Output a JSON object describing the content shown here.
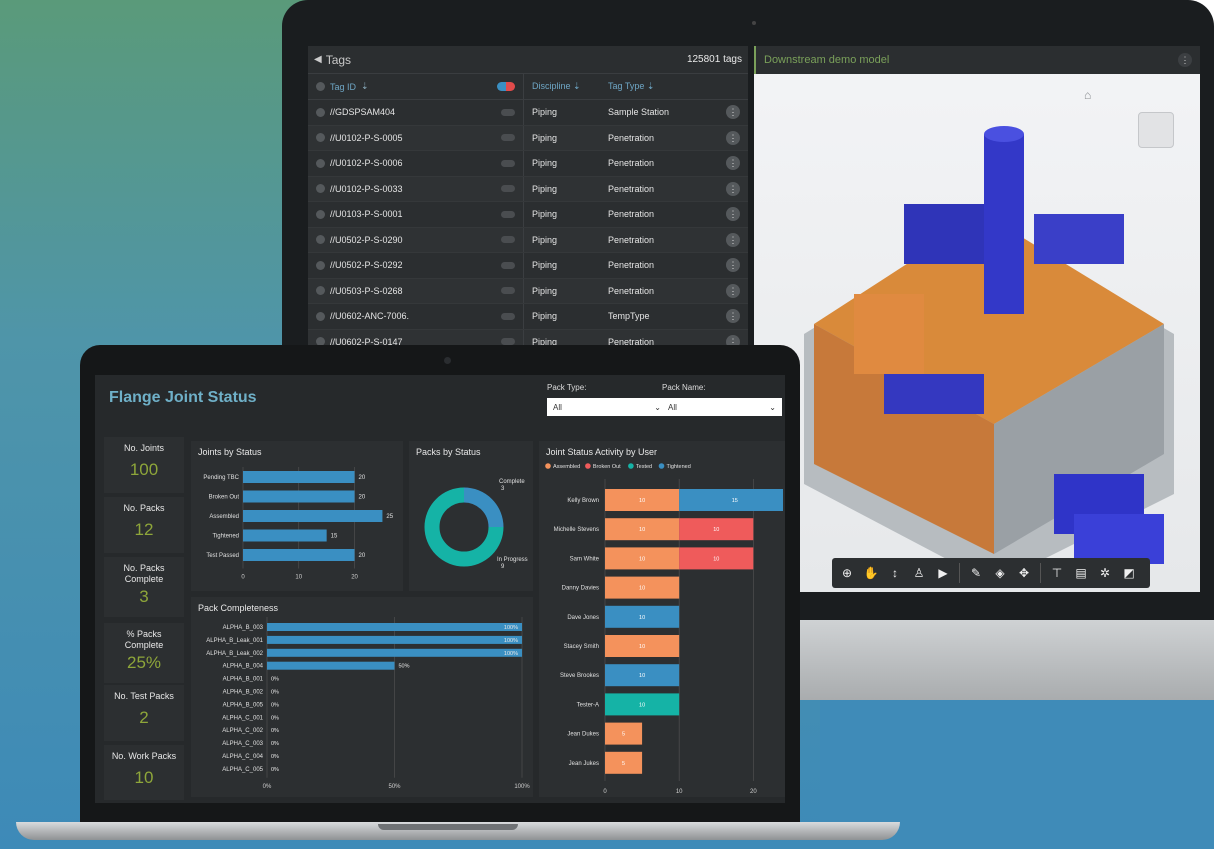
{
  "colors": {
    "accent": "#3a8fc2",
    "green_kpi": "#8ea63a",
    "assembled": "#f4925c",
    "broken_out": "#ef5b5b",
    "tested": "#15b3a6",
    "tightened": "#3a8fc2"
  },
  "tags": {
    "title": "Tags",
    "count": "125801 tags",
    "columns": {
      "id": "Tag ID",
      "discipline": "Discipline",
      "type": "Tag Type"
    },
    "rows": [
      {
        "id": "//GDSPSAM404",
        "discipline": "Piping",
        "type": "Sample Station"
      },
      {
        "id": "//U0102-P-S-0005",
        "discipline": "Piping",
        "type": "Penetration"
      },
      {
        "id": "//U0102-P-S-0006",
        "discipline": "Piping",
        "type": "Penetration"
      },
      {
        "id": "//U0102-P-S-0033",
        "discipline": "Piping",
        "type": "Penetration"
      },
      {
        "id": "//U0103-P-S-0001",
        "discipline": "Piping",
        "type": "Penetration"
      },
      {
        "id": "//U0502-P-S-0290",
        "discipline": "Piping",
        "type": "Penetration"
      },
      {
        "id": "//U0502-P-S-0292",
        "discipline": "Piping",
        "type": "Penetration"
      },
      {
        "id": "//U0503-P-S-0268",
        "discipline": "Piping",
        "type": "Penetration"
      },
      {
        "id": "//U0602-ANC-7006.",
        "discipline": "Piping",
        "type": "TempType"
      },
      {
        "id": "//U0602-P-S-0147",
        "discipline": "Piping",
        "type": "Penetration"
      }
    ]
  },
  "viewer": {
    "title": "Downstream demo model"
  },
  "dashboard": {
    "title": "Flange Joint Status",
    "filters": [
      {
        "label": "Pack Type:",
        "value": "All"
      },
      {
        "label": "Pack Name:",
        "value": "All"
      }
    ],
    "kpis": [
      {
        "label": "No. Joints",
        "value": "100"
      },
      {
        "label": "No. Packs",
        "value": "12"
      },
      {
        "label": "No. Packs Complete",
        "value": "3"
      },
      {
        "label": "% Packs Complete",
        "value": "25%"
      },
      {
        "label": "No. Test Packs",
        "value": "2"
      },
      {
        "label": "No. Work Packs",
        "value": "10"
      }
    ]
  },
  "chart_data": [
    {
      "type": "bar",
      "title": "Joints by Status",
      "orientation": "horizontal",
      "categories": [
        "Pending TBC",
        "Broken Out",
        "Assembled",
        "Tightened",
        "Test Passed"
      ],
      "values": [
        20,
        20,
        25,
        15,
        20
      ],
      "xlim": [
        0,
        26
      ],
      "xticks": [
        "0",
        "10",
        "20"
      ]
    },
    {
      "type": "pie",
      "title": "Packs by Status",
      "categories": [
        "Complete",
        "In Progress"
      ],
      "values": [
        3,
        9
      ]
    },
    {
      "type": "bar",
      "title": "Pack Completeness",
      "orientation": "horizontal",
      "categories": [
        "ALPHA_B_003",
        "ALPHA_B_Leak_001",
        "ALPHA_B_Leak_002",
        "ALPHA_B_004",
        "ALPHA_B_001",
        "ALPHA_B_002",
        "ALPHA_B_005",
        "ALPHA_C_001",
        "ALPHA_C_002",
        "ALPHA_C_003",
        "ALPHA_C_004",
        "ALPHA_C_005"
      ],
      "values": [
        100,
        100,
        100,
        50,
        0,
        0,
        0,
        0,
        0,
        0,
        0,
        0
      ],
      "data_labels": [
        "100%",
        "100%",
        "100%",
        "50%",
        "0%",
        "0%",
        "0%",
        "0%",
        "0%",
        "0%",
        "0%",
        "0%"
      ],
      "xticks": [
        "0%",
        "50%",
        "100%"
      ]
    },
    {
      "type": "bar",
      "title": "Joint Status Activity by User",
      "orientation": "horizontal",
      "stacked": true,
      "legend": [
        "Assembled",
        "Broken Out",
        "Tested",
        "Tightened"
      ],
      "categories": [
        "Kelly Brown",
        "Michelle Stevens",
        "Sam White",
        "Danny Davies",
        "Dave Jones",
        "Stacey Smith",
        "Steve Brookes",
        "Tester-A",
        "Jean Dukes",
        "Jean Jukes"
      ],
      "series": [
        {
          "name": "Assembled",
          "values": [
            10,
            10,
            10,
            10,
            0,
            10,
            0,
            0,
            5,
            5
          ]
        },
        {
          "name": "Broken Out",
          "values": [
            0,
            10,
            10,
            0,
            0,
            0,
            0,
            0,
            0,
            0
          ]
        },
        {
          "name": "Tested",
          "values": [
            0,
            0,
            0,
            0,
            0,
            0,
            0,
            10,
            0,
            0
          ]
        },
        {
          "name": "Tightened",
          "values": [
            15,
            0,
            0,
            0,
            10,
            0,
            10,
            0,
            0,
            0
          ]
        }
      ],
      "xticks": [
        "0",
        "10",
        "20"
      ]
    }
  ]
}
